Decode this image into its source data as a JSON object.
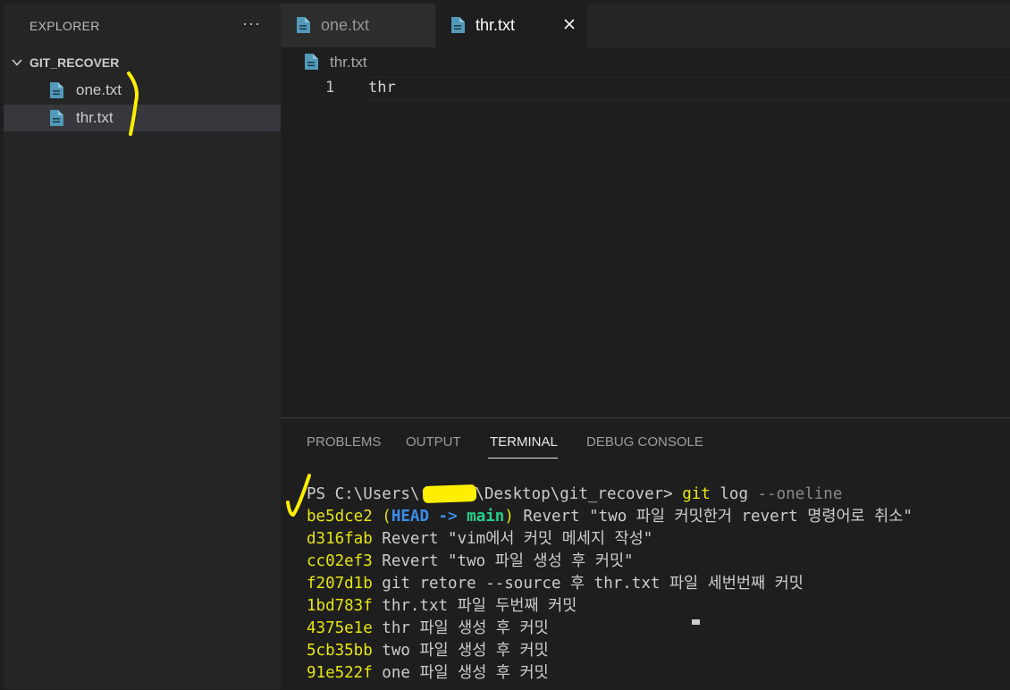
{
  "sidebar": {
    "title": "EXPLORER",
    "more": "···",
    "folder": "GIT_RECOVER",
    "files": [
      {
        "label": "one.txt",
        "icon": "file-icon",
        "selected": false
      },
      {
        "label": "thr.txt",
        "icon": "file-icon",
        "selected": true
      }
    ]
  },
  "tabs": [
    {
      "label": "one.txt",
      "active": false
    },
    {
      "label": "thr.txt",
      "active": true
    }
  ],
  "breadcrumb": {
    "file": "thr.txt"
  },
  "editor": {
    "line_number": "1",
    "line_text": "thr"
  },
  "panel": {
    "tabs": [
      "PROBLEMS",
      "OUTPUT",
      "TERMINAL",
      "DEBUG CONSOLE"
    ],
    "active_tab": "TERMINAL"
  },
  "terminal": {
    "prompt_prefix": "PS C:\\Users\\",
    "prompt_suffix": "\\Desktop\\git_recover> ",
    "command": "git",
    "command_args": " log ",
    "command_flag": "--oneline",
    "head_line": {
      "hash": "be5dce2",
      "open": " (",
      "head": "HEAD",
      "arrow": " -> ",
      "branch": "main",
      "close": ")",
      "message": " Revert \"two 파일 커밋한거 revert 명령어로 취소\""
    },
    "commits": [
      {
        "hash": "d316fab",
        "message": " Revert \"vim에서 커밋 메세지 작성\""
      },
      {
        "hash": "cc02ef3",
        "message": " Revert \"two 파일 생성 후 커밋\""
      },
      {
        "hash": "f207d1b",
        "message": " git retore --source 후 thr.txt 파일 세번번째 커밋"
      },
      {
        "hash": "1bd783f",
        "message": " thr.txt 파일 두번째 커밋"
      },
      {
        "hash": "4375e1e",
        "message": " thr 파일 생성 후 커밋"
      },
      {
        "hash": "5cb35bb",
        "message": " two 파일 생성 후 커밋"
      },
      {
        "hash": "91e522f",
        "message": " one 파일 생성 후 커밋"
      }
    ]
  },
  "colors": {
    "annotation": "#ffee00",
    "file_icon": "#519aba",
    "hash": "#e5e510",
    "head": "#3b8eea",
    "branch": "#23d18b"
  }
}
